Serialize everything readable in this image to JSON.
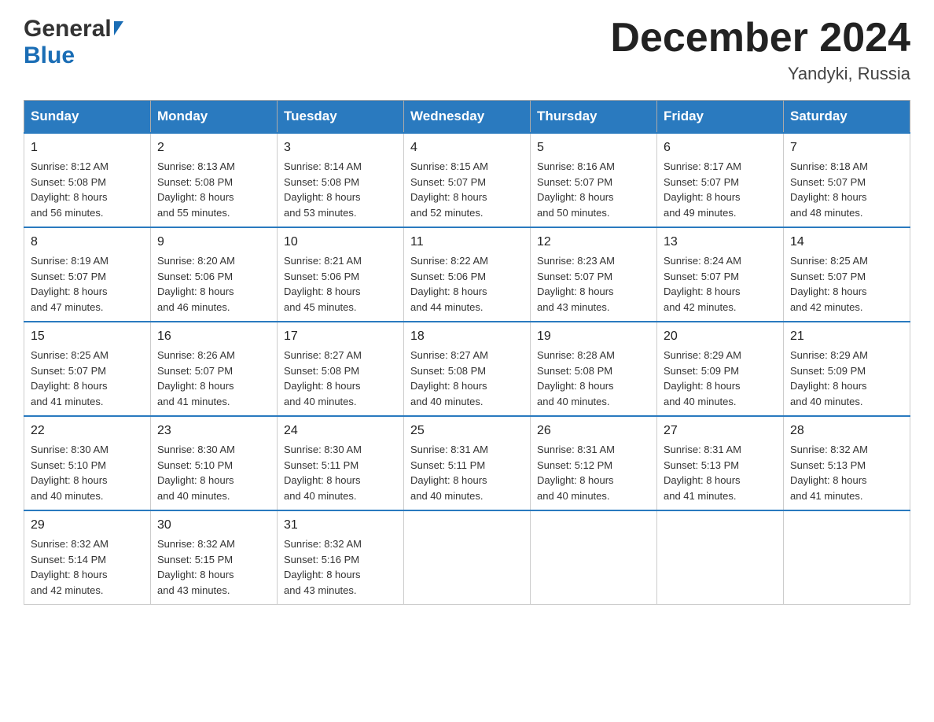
{
  "header": {
    "logo_general": "General",
    "logo_blue": "Blue",
    "month_title": "December 2024",
    "location": "Yandyki, Russia"
  },
  "days_of_week": [
    "Sunday",
    "Monday",
    "Tuesday",
    "Wednesday",
    "Thursday",
    "Friday",
    "Saturday"
  ],
  "weeks": [
    {
      "days": [
        {
          "num": "1",
          "sunrise": "8:12 AM",
          "sunset": "5:08 PM",
          "daylight": "8 hours and 56 minutes."
        },
        {
          "num": "2",
          "sunrise": "8:13 AM",
          "sunset": "5:08 PM",
          "daylight": "8 hours and 55 minutes."
        },
        {
          "num": "3",
          "sunrise": "8:14 AM",
          "sunset": "5:08 PM",
          "daylight": "8 hours and 53 minutes."
        },
        {
          "num": "4",
          "sunrise": "8:15 AM",
          "sunset": "5:07 PM",
          "daylight": "8 hours and 52 minutes."
        },
        {
          "num": "5",
          "sunrise": "8:16 AM",
          "sunset": "5:07 PM",
          "daylight": "8 hours and 50 minutes."
        },
        {
          "num": "6",
          "sunrise": "8:17 AM",
          "sunset": "5:07 PM",
          "daylight": "8 hours and 49 minutes."
        },
        {
          "num": "7",
          "sunrise": "8:18 AM",
          "sunset": "5:07 PM",
          "daylight": "8 hours and 48 minutes."
        }
      ]
    },
    {
      "days": [
        {
          "num": "8",
          "sunrise": "8:19 AM",
          "sunset": "5:07 PM",
          "daylight": "8 hours and 47 minutes."
        },
        {
          "num": "9",
          "sunrise": "8:20 AM",
          "sunset": "5:06 PM",
          "daylight": "8 hours and 46 minutes."
        },
        {
          "num": "10",
          "sunrise": "8:21 AM",
          "sunset": "5:06 PM",
          "daylight": "8 hours and 45 minutes."
        },
        {
          "num": "11",
          "sunrise": "8:22 AM",
          "sunset": "5:06 PM",
          "daylight": "8 hours and 44 minutes."
        },
        {
          "num": "12",
          "sunrise": "8:23 AM",
          "sunset": "5:07 PM",
          "daylight": "8 hours and 43 minutes."
        },
        {
          "num": "13",
          "sunrise": "8:24 AM",
          "sunset": "5:07 PM",
          "daylight": "8 hours and 42 minutes."
        },
        {
          "num": "14",
          "sunrise": "8:25 AM",
          "sunset": "5:07 PM",
          "daylight": "8 hours and 42 minutes."
        }
      ]
    },
    {
      "days": [
        {
          "num": "15",
          "sunrise": "8:25 AM",
          "sunset": "5:07 PM",
          "daylight": "8 hours and 41 minutes."
        },
        {
          "num": "16",
          "sunrise": "8:26 AM",
          "sunset": "5:07 PM",
          "daylight": "8 hours and 41 minutes."
        },
        {
          "num": "17",
          "sunrise": "8:27 AM",
          "sunset": "5:08 PM",
          "daylight": "8 hours and 40 minutes."
        },
        {
          "num": "18",
          "sunrise": "8:27 AM",
          "sunset": "5:08 PM",
          "daylight": "8 hours and 40 minutes."
        },
        {
          "num": "19",
          "sunrise": "8:28 AM",
          "sunset": "5:08 PM",
          "daylight": "8 hours and 40 minutes."
        },
        {
          "num": "20",
          "sunrise": "8:29 AM",
          "sunset": "5:09 PM",
          "daylight": "8 hours and 40 minutes."
        },
        {
          "num": "21",
          "sunrise": "8:29 AM",
          "sunset": "5:09 PM",
          "daylight": "8 hours and 40 minutes."
        }
      ]
    },
    {
      "days": [
        {
          "num": "22",
          "sunrise": "8:30 AM",
          "sunset": "5:10 PM",
          "daylight": "8 hours and 40 minutes."
        },
        {
          "num": "23",
          "sunrise": "8:30 AM",
          "sunset": "5:10 PM",
          "daylight": "8 hours and 40 minutes."
        },
        {
          "num": "24",
          "sunrise": "8:30 AM",
          "sunset": "5:11 PM",
          "daylight": "8 hours and 40 minutes."
        },
        {
          "num": "25",
          "sunrise": "8:31 AM",
          "sunset": "5:11 PM",
          "daylight": "8 hours and 40 minutes."
        },
        {
          "num": "26",
          "sunrise": "8:31 AM",
          "sunset": "5:12 PM",
          "daylight": "8 hours and 40 minutes."
        },
        {
          "num": "27",
          "sunrise": "8:31 AM",
          "sunset": "5:13 PM",
          "daylight": "8 hours and 41 minutes."
        },
        {
          "num": "28",
          "sunrise": "8:32 AM",
          "sunset": "5:13 PM",
          "daylight": "8 hours and 41 minutes."
        }
      ]
    },
    {
      "days": [
        {
          "num": "29",
          "sunrise": "8:32 AM",
          "sunset": "5:14 PM",
          "daylight": "8 hours and 42 minutes."
        },
        {
          "num": "30",
          "sunrise": "8:32 AM",
          "sunset": "5:15 PM",
          "daylight": "8 hours and 43 minutes."
        },
        {
          "num": "31",
          "sunrise": "8:32 AM",
          "sunset": "5:16 PM",
          "daylight": "8 hours and 43 minutes."
        },
        null,
        null,
        null,
        null
      ]
    }
  ],
  "labels": {
    "sunrise": "Sunrise:",
    "sunset": "Sunset:",
    "daylight": "Daylight:"
  },
  "colors": {
    "header_bg": "#2a7abf",
    "header_text": "#ffffff",
    "border": "#aaaaaa",
    "row_border": "#2a7abf"
  }
}
